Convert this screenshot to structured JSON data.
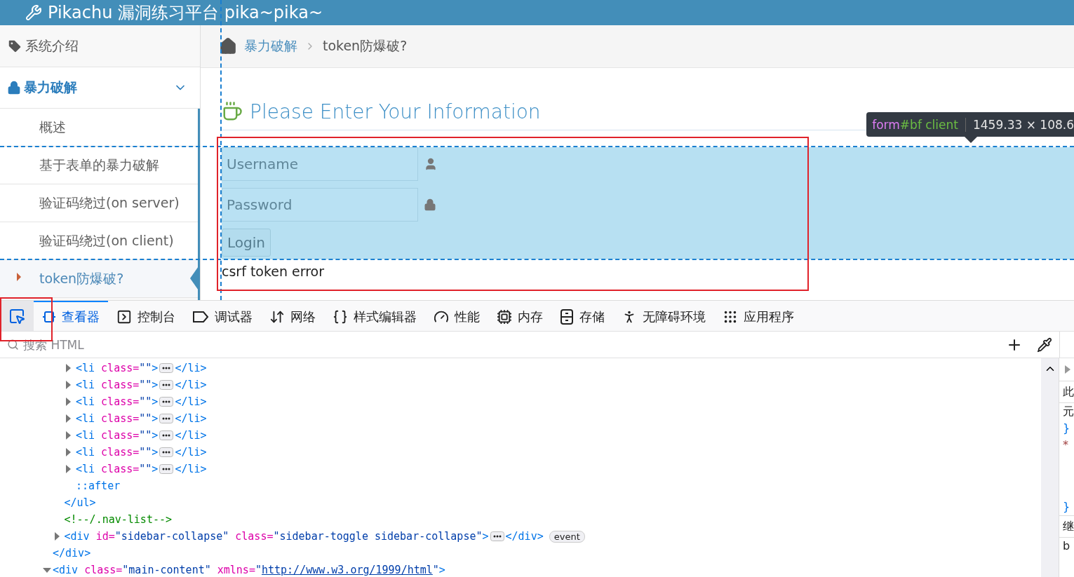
{
  "header": {
    "title": "Pikachu 漏洞练习平台 pika~pika~"
  },
  "sidebar": {
    "items": [
      {
        "label": "系统介绍",
        "kind": "section",
        "selected": false
      },
      {
        "label": "暴力破解",
        "kind": "section",
        "expanded": true,
        "selected": true,
        "children": [
          {
            "label": "概述",
            "selected": false
          },
          {
            "label": "基于表单的暴力破解",
            "selected": false
          },
          {
            "label": "验证码绕过(on server)",
            "selected": false
          },
          {
            "label": "验证码绕过(on client)",
            "selected": false
          },
          {
            "label": "token防爆破?",
            "selected": true
          }
        ]
      }
    ]
  },
  "breadcrumb": [
    "暴力破解",
    "token防爆破?"
  ],
  "page": {
    "heading": "Please Enter Your Information",
    "username": {
      "placeholder": "Username"
    },
    "password": {
      "placeholder": "Password"
    },
    "login_button": "Login",
    "message": "csrf token error"
  },
  "highlight_tooltip": {
    "tag": "form",
    "selector": "#bf client",
    "size": "1459.33 × 108.6"
  },
  "devtools": {
    "tabs": [
      {
        "label": "查看器",
        "selected": true
      },
      {
        "label": "控制台",
        "selected": false
      },
      {
        "label": "调试器",
        "selected": false
      },
      {
        "label": "网络",
        "selected": false
      },
      {
        "label": "样式编辑器",
        "selected": false
      },
      {
        "label": "性能",
        "selected": false
      },
      {
        "label": "内存",
        "selected": false
      },
      {
        "label": "存储",
        "selected": false
      },
      {
        "label": "无障碍环境",
        "selected": false
      },
      {
        "label": "应用程序",
        "selected": false
      }
    ],
    "picker": {
      "selected": true
    },
    "search": {
      "placeholder": "搜索 HTML"
    },
    "tree": [
      {
        "children": [
          {
            "children": [
              {
                "expanded": false,
                "tokens": [
                  {
                    "kind": "tag",
                    "text": "<li"
                  },
                  {
                    "kind": "attr",
                    "text": "class="
                  },
                  {
                    "kind": "value",
                    "text": "\"\""
                  },
                  {
                    "kind": "tag",
                    "text": ">"
                  },
                  {
                    "kind": "more"
                  },
                  {
                    "kind": "tag",
                    "text": "</li>"
                  }
                ]
              },
              {
                "expanded": false,
                "tokens": [
                  {
                    "kind": "tag",
                    "text": "<li"
                  },
                  {
                    "kind": "attr",
                    "text": "class="
                  },
                  {
                    "kind": "value",
                    "text": "\"\""
                  },
                  {
                    "kind": "tag",
                    "text": ">"
                  },
                  {
                    "kind": "more"
                  },
                  {
                    "kind": "tag",
                    "text": "</li>"
                  }
                ]
              },
              {
                "expanded": false,
                "tokens": [
                  {
                    "kind": "tag",
                    "text": "<li"
                  },
                  {
                    "kind": "attr",
                    "text": "class="
                  },
                  {
                    "kind": "value",
                    "text": "\"\""
                  },
                  {
                    "kind": "tag",
                    "text": ">"
                  },
                  {
                    "kind": "more"
                  },
                  {
                    "kind": "tag",
                    "text": "</li>"
                  }
                ]
              },
              {
                "expanded": false,
                "tokens": [
                  {
                    "kind": "tag",
                    "text": "<li"
                  },
                  {
                    "kind": "attr",
                    "text": "class="
                  },
                  {
                    "kind": "value",
                    "text": "\"\""
                  },
                  {
                    "kind": "tag",
                    "text": ">"
                  },
                  {
                    "kind": "more"
                  },
                  {
                    "kind": "tag",
                    "text": "</li>"
                  }
                ]
              },
              {
                "expanded": false,
                "tokens": [
                  {
                    "kind": "tag",
                    "text": "<li"
                  },
                  {
                    "kind": "attr",
                    "text": "class="
                  },
                  {
                    "kind": "value",
                    "text": "\"\""
                  },
                  {
                    "kind": "tag",
                    "text": ">"
                  },
                  {
                    "kind": "more"
                  },
                  {
                    "kind": "tag",
                    "text": "</li>"
                  }
                ]
              },
              {
                "expanded": false,
                "tokens": [
                  {
                    "kind": "tag",
                    "text": "<li"
                  },
                  {
                    "kind": "attr",
                    "text": "class="
                  },
                  {
                    "kind": "value",
                    "text": "\"\""
                  },
                  {
                    "kind": "tag",
                    "text": ">"
                  },
                  {
                    "kind": "more"
                  },
                  {
                    "kind": "tag",
                    "text": "</li>"
                  }
                ]
              },
              {
                "expanded": false,
                "tokens": [
                  {
                    "kind": "tag",
                    "text": "<li"
                  },
                  {
                    "kind": "attr",
                    "text": "class="
                  },
                  {
                    "kind": "value",
                    "text": "\"\""
                  },
                  {
                    "kind": "tag",
                    "text": ">"
                  },
                  {
                    "kind": "more"
                  },
                  {
                    "kind": "tag",
                    "text": "</li>"
                  }
                ]
              },
              {
                "tokens": [
                  {
                    "kind": "pseudo",
                    "text": "::after"
                  }
                ]
              }
            ],
            "close": "</ul>"
          },
          {
            "tokens": [
              {
                "kind": "comment",
                "text": "<!--/.nav-list-->"
              }
            ]
          },
          {
            "expanded": false,
            "tokens": [
              {
                "kind": "tag",
                "text": "<div"
              },
              {
                "kind": "attr",
                "text": "id="
              },
              {
                "kind": "value",
                "text": "\"sidebar-collapse\""
              },
              {
                "kind": "attr",
                "text": "class="
              },
              {
                "kind": "value",
                "text": "\"sidebar-toggle sidebar-collapse\""
              },
              {
                "kind": "tag",
                "text": ">"
              },
              {
                "kind": "more"
              },
              {
                "kind": "tag",
                "text": "</div>"
              },
              {
                "kind": "badge",
                "text": "event"
              }
            ]
          }
        ],
        "close": "</div>"
      },
      {
        "expanded": true,
        "tokens": [
          {
            "kind": "tag",
            "text": "<div"
          },
          {
            "kind": "attr",
            "text": "class="
          },
          {
            "kind": "value",
            "text": "\"main-content\""
          },
          {
            "kind": "attr",
            "text": "xmlns="
          },
          {
            "kind": "value",
            "text": "\""
          },
          {
            "kind": "link",
            "text": "http://www.w3.org/1999/html"
          },
          {
            "kind": "value",
            "text": "\""
          },
          {
            "kind": "tag",
            "text": ">"
          }
        ]
      }
    ],
    "side_pane": [
      {
        "kind": "heading",
        "text": "此"
      },
      {
        "kind": "text",
        "text": "元"
      },
      {
        "kind": "brace",
        "text": "}"
      },
      {
        "kind": "star",
        "text": "*"
      },
      {
        "kind": "brace",
        "text": "}"
      },
      {
        "kind": "heading",
        "text": "继"
      },
      {
        "kind": "text",
        "text": "b"
      }
    ]
  }
}
